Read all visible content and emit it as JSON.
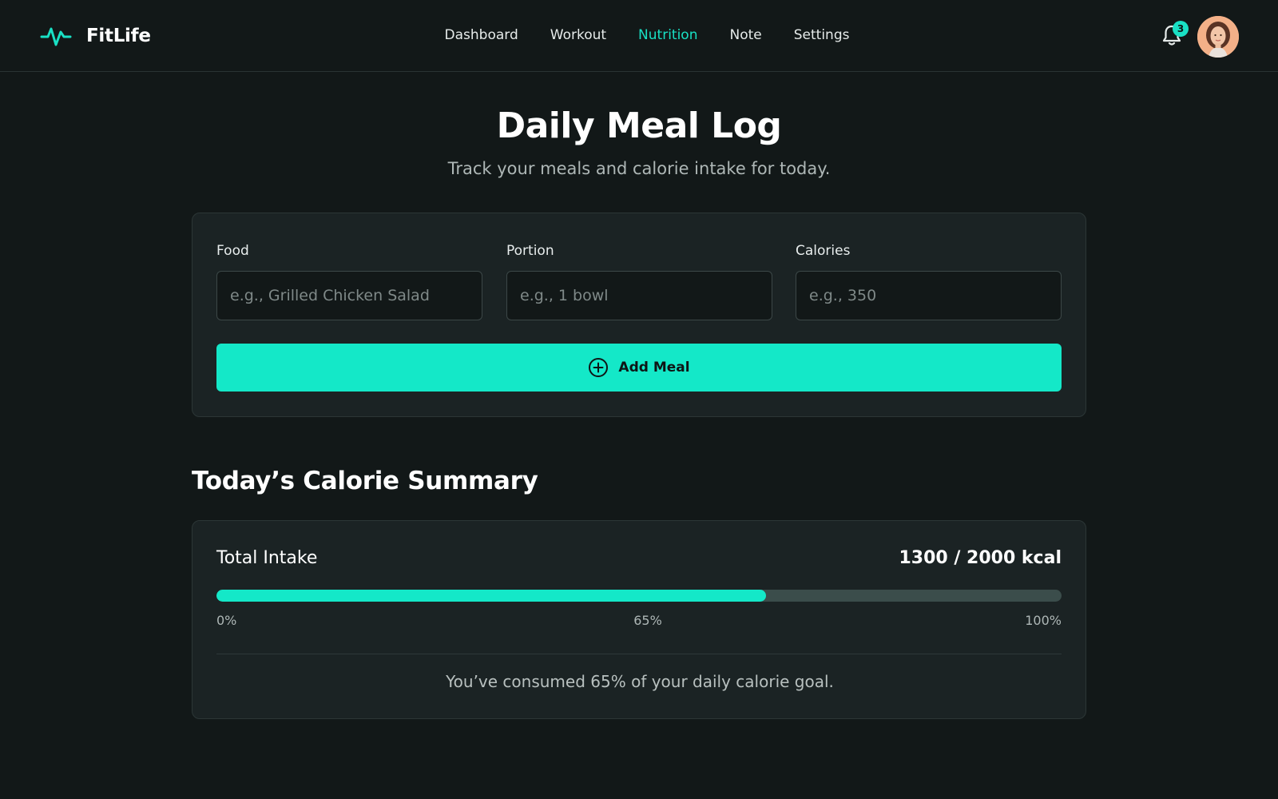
{
  "brand": {
    "name": "FitLife",
    "icon": "pulse-icon",
    "accent": "#19e0c4"
  },
  "nav": {
    "items": [
      {
        "label": "Dashboard",
        "active": false
      },
      {
        "label": "Workout",
        "active": false
      },
      {
        "label": "Nutrition",
        "active": true
      },
      {
        "label": "Note",
        "active": false
      },
      {
        "label": "Settings",
        "active": false
      }
    ]
  },
  "notifications": {
    "icon": "bell-icon",
    "count": "3"
  },
  "user": {
    "avatar": "avatar"
  },
  "header": {
    "title": "Daily Meal Log",
    "subtitle": "Track your meals and calorie intake for today."
  },
  "form": {
    "food": {
      "label": "Food",
      "placeholder": "e.g., Grilled Chicken Salad",
      "value": ""
    },
    "portion": {
      "label": "Portion",
      "placeholder": "e.g., 1 bowl",
      "value": ""
    },
    "calories": {
      "label": "Calories",
      "placeholder": "e.g., 350",
      "value": ""
    },
    "add_button": {
      "label": "Add Meal",
      "icon": "plus-circle-icon"
    }
  },
  "summary": {
    "section_title": "Today’s Calorie Summary",
    "intake_label": "Total Intake",
    "intake_value": "1300 / 2000 kcal",
    "progress_percent": 65,
    "tick_start": "0%",
    "tick_mid": "65%",
    "tick_end": "100%",
    "note": "You’ve consumed 65% of your daily calorie goal."
  }
}
